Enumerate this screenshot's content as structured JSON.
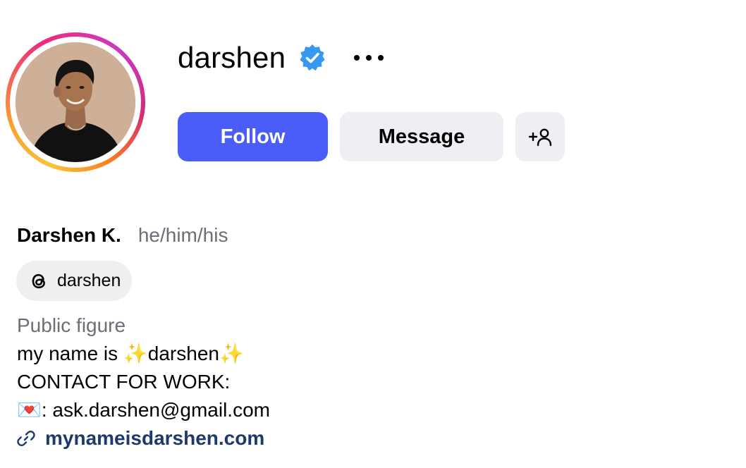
{
  "profile": {
    "username": "darshen",
    "verified": true,
    "full_name": "Darshen K.",
    "pronouns": "he/him/his"
  },
  "icons": {
    "verified": "verified-badge-icon",
    "more": "more-options-icon",
    "add_user": "add-user-icon",
    "threads": "threads-icon",
    "link": "link-icon"
  },
  "actions": {
    "follow_label": "Follow",
    "message_label": "Message"
  },
  "threads": {
    "handle": "darshen"
  },
  "bio": {
    "category": "Public figure",
    "line1": "my name is ✨darshen✨",
    "line2": "CONTACT FOR WORK:",
    "line3": "💌: ask.darshen@gmail.com",
    "link": "mynameisdarshen.com"
  },
  "colors": {
    "follow_bg": "#4a5df9",
    "secondary_bg": "#efeff3",
    "verified_blue": "#3897f0",
    "link_color": "#1e3a6d",
    "muted_text": "#6b6f77"
  }
}
